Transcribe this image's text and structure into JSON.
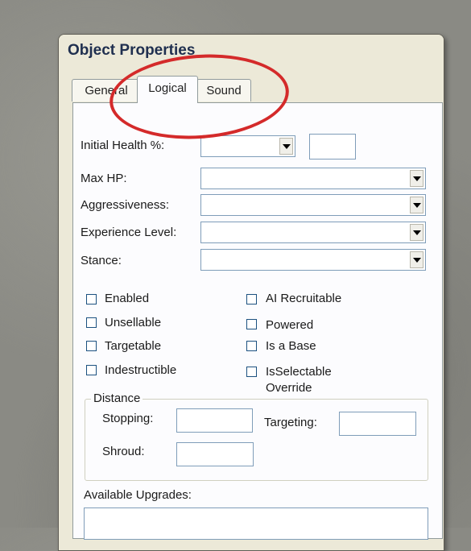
{
  "window": {
    "title": "Object Properties"
  },
  "tabs": [
    {
      "label": "General"
    },
    {
      "label": "Logical",
      "active": true
    },
    {
      "label": "Sound"
    }
  ],
  "fields": {
    "initial_health": {
      "label": "Initial Health %:",
      "value": "",
      "text_value": ""
    },
    "max_hp": {
      "label": "Max HP:",
      "value": ""
    },
    "aggressiveness": {
      "label": "Aggressiveness:",
      "value": ""
    },
    "experience_level": {
      "label": "Experience Level:",
      "value": ""
    },
    "stance": {
      "label": "Stance:",
      "value": ""
    }
  },
  "checkboxes": {
    "left": [
      {
        "label": "Enabled",
        "checked": false
      },
      {
        "label": "Unsellable",
        "checked": false
      },
      {
        "label": "Targetable",
        "checked": false
      },
      {
        "label": "Indestructible",
        "checked": false
      }
    ],
    "right": [
      {
        "label": "AI Recruitable",
        "checked": false
      },
      {
        "label": "Powered",
        "checked": false
      },
      {
        "label": "Is a Base",
        "checked": false
      },
      {
        "label": "IsSelectable Override",
        "checked": false
      }
    ]
  },
  "distance": {
    "legend": "Distance",
    "stopping_label": "Stopping:",
    "stopping_value": "",
    "targeting_label": "Targeting:",
    "targeting_value": "",
    "shroud_label": "Shroud:",
    "shroud_value": ""
  },
  "upgrades": {
    "label": "Available Upgrades:"
  },
  "colors": {
    "annotation": "#d42a2a",
    "title_text": "#1f2f4f"
  },
  "icons": {
    "dropdown": "chevron-down-icon",
    "annotation": "red-circle-annotation"
  }
}
